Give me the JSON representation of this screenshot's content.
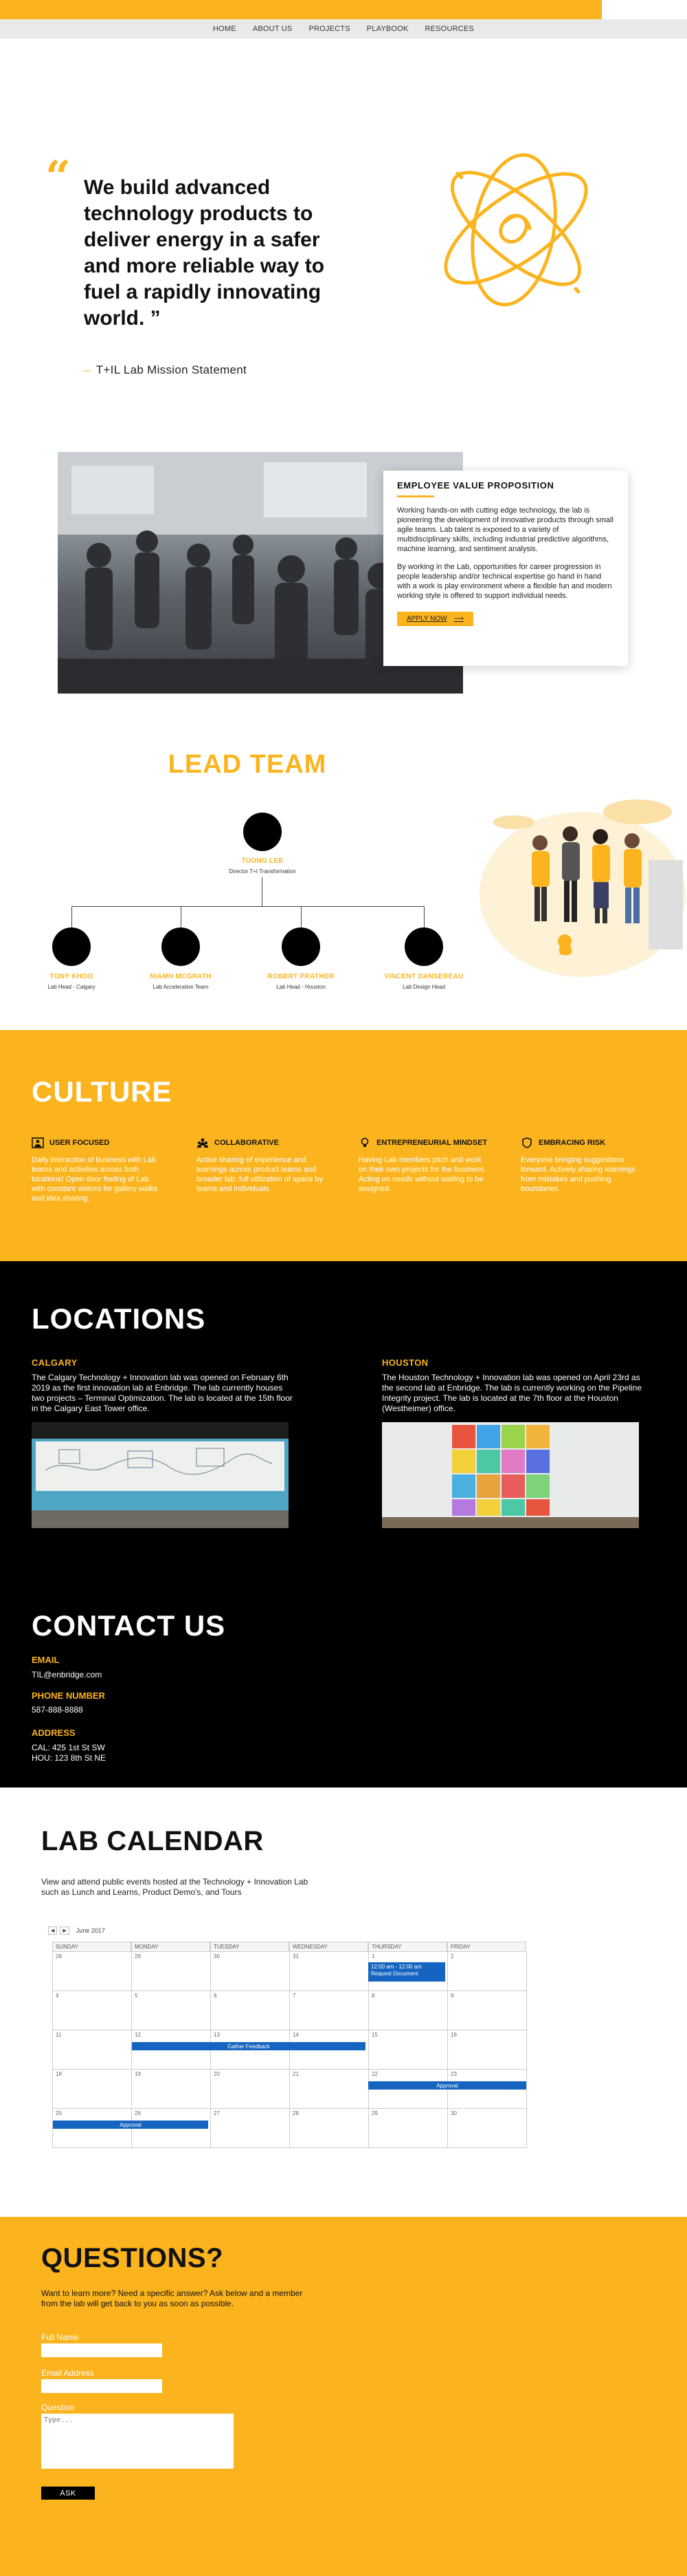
{
  "nav": [
    "HOME",
    "ABOUT US",
    "PROJECTS",
    "PLAYBOOK",
    "RESOURCES"
  ],
  "mission": {
    "quote_mark": "“",
    "text": "We build advanced technology products to deliver energy in a safer and more reliable way to fuel a rapidly innovating world. ”",
    "signature_dash": "–",
    "signature": "T+IL Lab Mission Statement"
  },
  "evp": {
    "title": "EMPLOYEE VALUE PROPOSITION",
    "p1": "Working hands-on with cutting edge technology, the lab is pioneering the development of innovative products through small agile teams. Lab talent is exposed to a variety of multidisciplinary skills, including industrial predictive algorithms, machine learning, and sentiment analysis.",
    "p2": "By working in the Lab, opportunities for career progression in people leadership and/or technical expertise go hand in hand with a work is play environment where a flexible fun and modern working style is offered to support individual needs.",
    "apply_label": "APPLY NOW",
    "apply_arrow": "⟶"
  },
  "lead_team": {
    "title": "LEAD TEAM",
    "head": {
      "name": "TUONG LEE",
      "role": "Director T+I Transformation"
    },
    "members": [
      {
        "name": "TONY KHOO",
        "role": "Lab Head - Calgary"
      },
      {
        "name": "NIAMH MCGRATH",
        "role": "Lab Acceleration Team"
      },
      {
        "name": "ROBERT PRATHER",
        "role": "Lab Head - Houston"
      },
      {
        "name": "VINCENT DANSEREAU",
        "role": "Lab Design Head"
      }
    ]
  },
  "culture": {
    "title": "CULTURE",
    "values": [
      {
        "title": "USER FOCUSED",
        "icon": "user-icon",
        "text": "Daily interaction of business with Lab teams and activities across both locations! Open door feeling of Lab with constant visitors for gallery walks and idea sharing."
      },
      {
        "title": "COLLABORATIVE",
        "icon": "people-icon",
        "text": "Active sharing of experience and learnings across product teams and broader lab; full utilization of space by teams and individuals."
      },
      {
        "title": "ENTREPRENEURIAL MINDSET",
        "icon": "lightbulb-icon",
        "text": "Having Lab members pitch and work on their own projects for the business. Acting on needs without waiting to be assigned."
      },
      {
        "title": "EMBRACING RISK",
        "icon": "shield-icon",
        "text": "Everyone bringing suggestions forward. Actively sharing learnings from mistakes and pushing boundaries."
      }
    ]
  },
  "locations": {
    "title": "LOCATIONS",
    "items": [
      {
        "city": "CALGARY",
        "text": "The Calgary Technology + Innovation lab was opened on February 6th 2019 as the first innovation lab at Enbridge. The lab currently houses two projects – Terminal Optimization. The lab is located at the 15th floor in the Calgary East Tower office."
      },
      {
        "city": "HOUSTON",
        "text": "The Houston Technology + Innovation lab was opened on April 23rd as the second lab at Enbridge. The lab is currently working on the Pipeline Integrity project. The lab is located at the 7th floor at the Houston (Westheimer) office."
      }
    ]
  },
  "contact": {
    "title": "CONTACT US",
    "email_label": "EMAIL",
    "email": "TIL@enbridge.com",
    "phone_label": "PHONE NUMBER",
    "phone": "587-888-8888",
    "address_label": "ADDRESS",
    "address_cal": "CAL: 425 1st St SW",
    "address_hou": "HOU: 123 8th St NE"
  },
  "calendar": {
    "title": "LAB CALENDAR",
    "desc": "View and attend public events hosted at the Technology + Innovation Lab such as Lunch and Learns, Product Demo's, and Tours",
    "prev": "◀",
    "next": "▶",
    "month": "June 2017",
    "days": [
      "SUNDAY",
      "MONDAY",
      "TUESDAY",
      "WEDNESDAY",
      "THURSDAY",
      "FRIDAY"
    ],
    "weeks": [
      [
        "28",
        "29",
        "30",
        "31",
        "1",
        "2"
      ],
      [
        "4",
        "5",
        "6",
        "7",
        "8",
        "9"
      ],
      [
        "11",
        "12",
        "13",
        "14",
        "15",
        "16"
      ],
      [
        "18",
        "19",
        "20",
        "21",
        "22",
        "23"
      ],
      [
        "25",
        "26",
        "27",
        "28",
        "29",
        "30"
      ]
    ],
    "events": {
      "review_time": "12:00 am - 12:00 am",
      "review_title": "Request Document",
      "feedback": "Gather Feedback",
      "approval_1": "Approval",
      "approval_2": "Approval"
    }
  },
  "questions": {
    "title": "QUESTIONS?",
    "desc": "Want to learn more? Need a specific answer? Ask below and a member from the lab will get back to you as soon as possible.",
    "name_label": "Full Name",
    "email_label": "Email Address",
    "question_label": "Question",
    "question_placeholder": "Type...",
    "ask_label": "ASK"
  }
}
